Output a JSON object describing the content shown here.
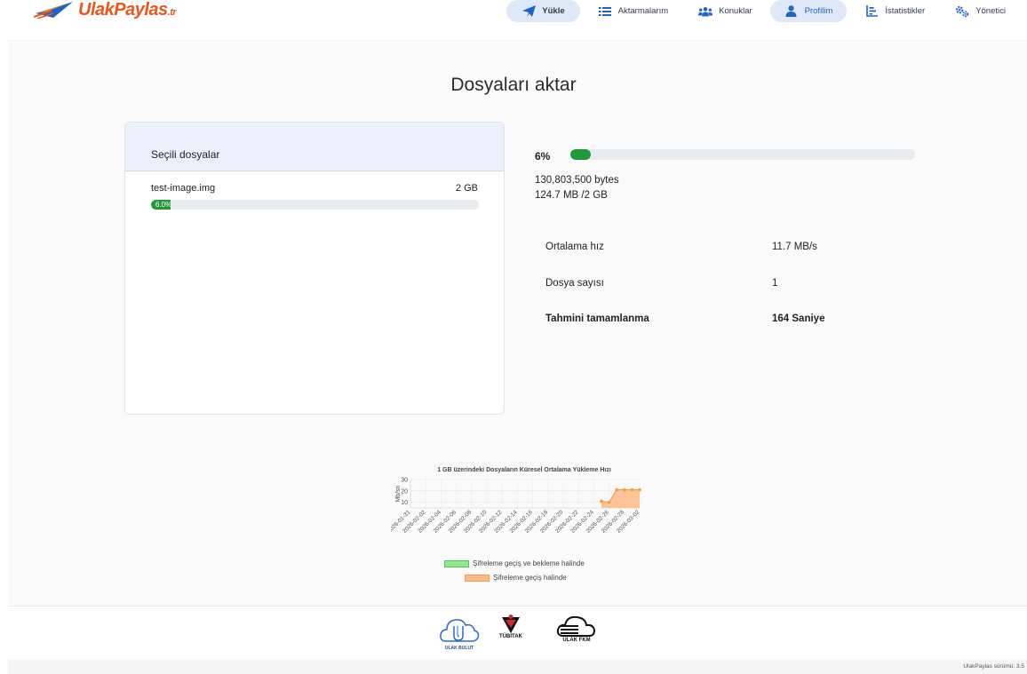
{
  "brand": {
    "name": "UlakPaylas",
    "suffix": ".tr"
  },
  "nav": [
    {
      "label": "Yükle",
      "icon": "paper-plane-icon",
      "active": true
    },
    {
      "label": "Aktarmalarım",
      "icon": "list-icon",
      "active": false
    },
    {
      "label": "Konuklar",
      "icon": "users-icon",
      "active": false
    },
    {
      "label": "Profilim",
      "icon": "user-icon",
      "active": true
    },
    {
      "label": "İstatistikler",
      "icon": "chart-bar-icon",
      "active": false
    },
    {
      "label": "Yönetici",
      "icon": "gears-icon",
      "active": false
    }
  ],
  "page": {
    "title": "Dosyaları aktar"
  },
  "files_card": {
    "header": "Seçili dosyalar",
    "files": [
      {
        "name": "test-image.img",
        "size": "2 GB",
        "progress_label": "6.0%",
        "progress": 0.06
      }
    ]
  },
  "progress": {
    "percent_label": "6%",
    "fraction": 0.06,
    "bytes": "130,803,500 bytes",
    "transferred": "124.7 MB /2 GB"
  },
  "stats": [
    {
      "label": "Ortalama hız",
      "value": "11.7 MB/s",
      "bold": false
    },
    {
      "label": "Dosya sayısı",
      "value": "1",
      "bold": false
    },
    {
      "label": "Tahmini tamamlanma",
      "value": "164 Saniye",
      "bold": true
    }
  ],
  "chart_data": {
    "type": "area",
    "title": "1 GB üzerindeki Dosyaların Küresel Ortalama Yükleme Hızı",
    "ylabel": "Mb/sn",
    "xlabel": "",
    "ylim": [
      5,
      30
    ],
    "yticks": [
      10,
      20,
      30
    ],
    "grid": true,
    "legend_position": "bottom",
    "x": [
      "2026-01-31",
      "2026-02-02",
      "2026-02-04",
      "2026-02-06",
      "2026-02-08",
      "2026-02-10",
      "2026-02-12",
      "2026-02-14",
      "2026-02-16",
      "2026-02-18",
      "2026-02-20",
      "2026-02-22",
      "2026-02-24",
      "2026-02-26",
      "2026-02-28",
      "2026-03-02"
    ],
    "series": [
      {
        "name": "Şifreleme geçiş ve bekleme halinde",
        "color": "#90e88a",
        "border": "#52c64a",
        "points": []
      },
      {
        "name": "Şifreleme geçiş halinde",
        "color": "#fdbb83",
        "border": "#f59c4e",
        "points": [
          {
            "x": "2026-02-25",
            "y": 11
          },
          {
            "x": "2026-02-26",
            "y": 10
          },
          {
            "x": "2026-02-27",
            "y": 21
          },
          {
            "x": "2026-02-28",
            "y": 21
          },
          {
            "x": "2026-03-01",
            "y": 21
          },
          {
            "x": "2026-03-02",
            "y": 21
          }
        ]
      }
    ]
  },
  "footer": {
    "logos": [
      {
        "text": "ULAK BULUT",
        "icon": "ulak-bulut-logo"
      },
      {
        "text": "TÜBİTAK",
        "icon": "tubitak-logo"
      },
      {
        "text": "ULAK FKM",
        "icon": "ulak-fkm-logo"
      }
    ],
    "version": "UlakPaylas sürümü: 3.5"
  },
  "colors": {
    "progress": "#1e9a38",
    "nav_active": "#dfe8f6",
    "brand": "#e8571e",
    "brand_blue": "#1e63c8"
  }
}
